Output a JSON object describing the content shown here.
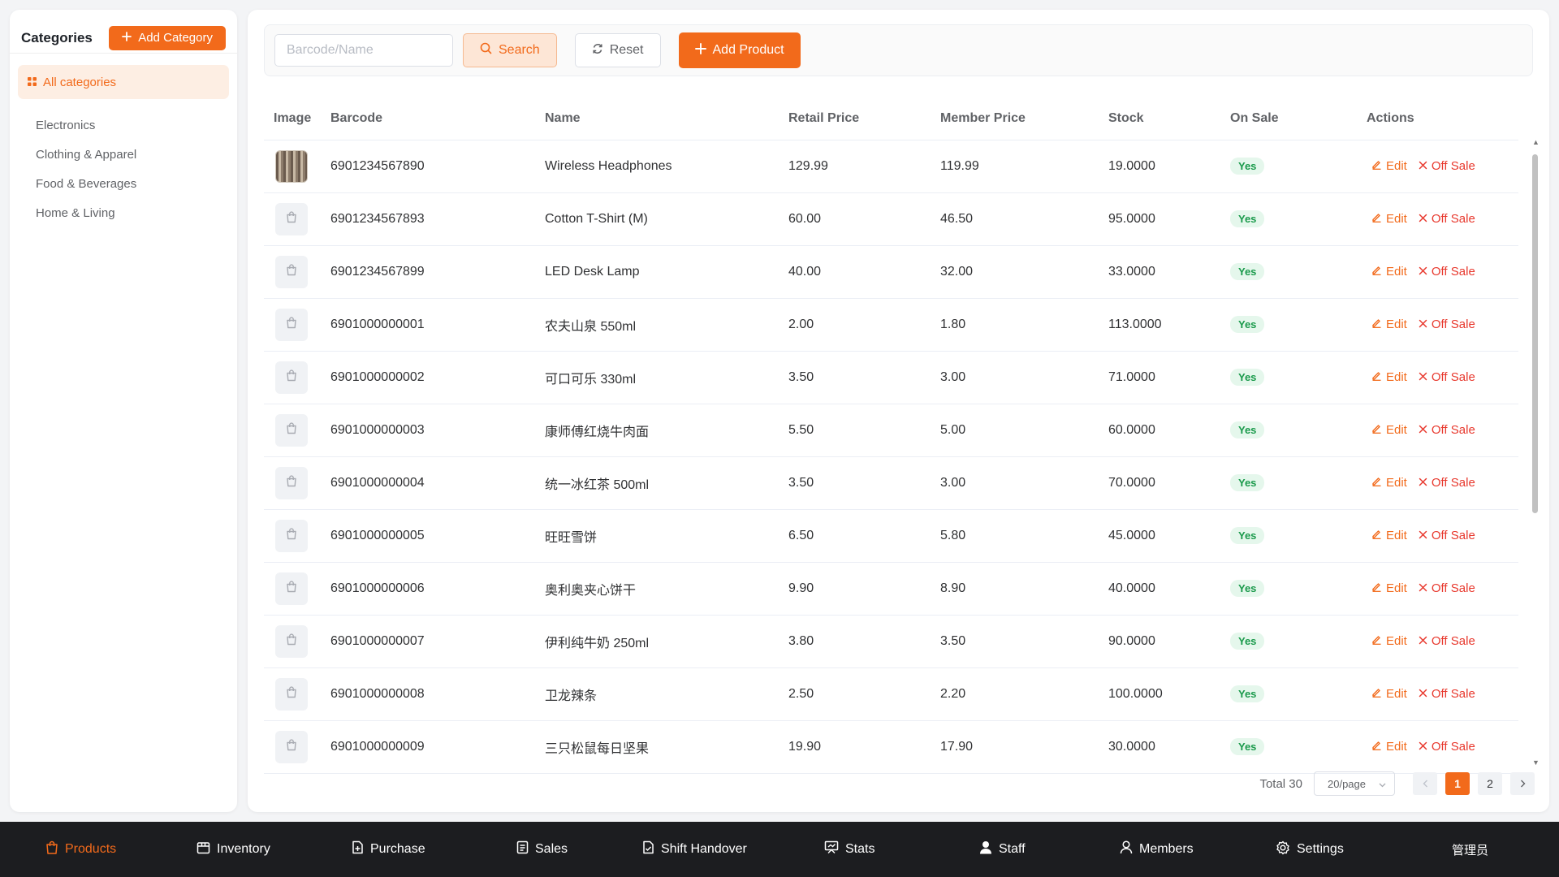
{
  "sidebar": {
    "title": "Categories",
    "add_label": "Add Category",
    "all_label": "All categories",
    "items": [
      {
        "label": "Electronics"
      },
      {
        "label": "Clothing & Apparel"
      },
      {
        "label": "Food & Beverages"
      },
      {
        "label": "Home & Living"
      }
    ]
  },
  "toolbar": {
    "search_placeholder": "Barcode/Name",
    "search_value": "",
    "search_label": "Search",
    "reset_label": "Reset",
    "add_product_label": "Add Product"
  },
  "table": {
    "headers": {
      "image": "Image",
      "barcode": "Barcode",
      "name": "Name",
      "retail": "Retail Price",
      "member": "Member Price",
      "stock": "Stock",
      "on_sale": "On Sale",
      "actions": "Actions"
    },
    "edit_label": "Edit",
    "off_sale_label": "Off Sale",
    "rows": [
      {
        "thumb": "photo",
        "barcode": "6901234567890",
        "name": "Wireless Headphones",
        "retail": "129.99",
        "member": "119.99",
        "stock": "19.0000",
        "on_sale": "Yes"
      },
      {
        "thumb": "bag-icon",
        "barcode": "6901234567893",
        "name": "Cotton T-Shirt (M)",
        "retail": "60.00",
        "member": "46.50",
        "stock": "95.0000",
        "on_sale": "Yes"
      },
      {
        "thumb": "bag-icon",
        "barcode": "6901234567899",
        "name": "LED Desk Lamp",
        "retail": "40.00",
        "member": "32.00",
        "stock": "33.0000",
        "on_sale": "Yes"
      },
      {
        "thumb": "bag-icon",
        "barcode": "6901000000001",
        "name": "农夫山泉 550ml",
        "retail": "2.00",
        "member": "1.80",
        "stock": "113.0000",
        "on_sale": "Yes"
      },
      {
        "thumb": "bag-icon",
        "barcode": "6901000000002",
        "name": "可口可乐 330ml",
        "retail": "3.50",
        "member": "3.00",
        "stock": "71.0000",
        "on_sale": "Yes"
      },
      {
        "thumb": "bag-icon",
        "barcode": "6901000000003",
        "name": "康师傅红烧牛肉面",
        "retail": "5.50",
        "member": "5.00",
        "stock": "60.0000",
        "on_sale": "Yes"
      },
      {
        "thumb": "bag-icon",
        "barcode": "6901000000004",
        "name": "统一冰红茶 500ml",
        "retail": "3.50",
        "member": "3.00",
        "stock": "70.0000",
        "on_sale": "Yes"
      },
      {
        "thumb": "bag-icon",
        "barcode": "6901000000005",
        "name": "旺旺雪饼",
        "retail": "6.50",
        "member": "5.80",
        "stock": "45.0000",
        "on_sale": "Yes"
      },
      {
        "thumb": "bag-icon",
        "barcode": "6901000000006",
        "name": "奥利奥夹心饼干",
        "retail": "9.90",
        "member": "8.90",
        "stock": "40.0000",
        "on_sale": "Yes"
      },
      {
        "thumb": "bag-icon",
        "barcode": "6901000000007",
        "name": "伊利纯牛奶 250ml",
        "retail": "3.80",
        "member": "3.50",
        "stock": "90.0000",
        "on_sale": "Yes"
      },
      {
        "thumb": "bag-icon",
        "barcode": "6901000000008",
        "name": "卫龙辣条",
        "retail": "2.50",
        "member": "2.20",
        "stock": "100.0000",
        "on_sale": "Yes"
      },
      {
        "thumb": "bag-icon",
        "barcode": "6901000000009",
        "name": "三只松鼠每日坚果",
        "retail": "19.90",
        "member": "17.90",
        "stock": "30.0000",
        "on_sale": "Yes"
      }
    ]
  },
  "pagination": {
    "total_label": "Total 30",
    "page_size": "20/page",
    "pages": [
      "1",
      "2"
    ],
    "current": "1"
  },
  "bottom_nav": {
    "items": [
      {
        "label": "Products",
        "icon": "bag-icon",
        "active": true
      },
      {
        "label": "Inventory",
        "icon": "box-icon",
        "active": false
      },
      {
        "label": "Purchase",
        "icon": "document-plus-icon",
        "active": false
      },
      {
        "label": "Sales",
        "icon": "list-document-icon",
        "active": false
      },
      {
        "label": "Shift Handover",
        "icon": "document-check-icon",
        "active": false
      },
      {
        "label": "Stats",
        "icon": "chart-board-icon",
        "active": false
      },
      {
        "label": "Staff",
        "icon": "user-filled-icon",
        "active": false
      },
      {
        "label": "Members",
        "icon": "user-outline-icon",
        "active": false
      },
      {
        "label": "Settings",
        "icon": "gear-icon",
        "active": false
      }
    ],
    "user_label": "管理员"
  },
  "colors": {
    "accent": "#f26a1b",
    "danger": "#e8382d",
    "success": "#1a9a4b",
    "nav_bg": "#1c1d20"
  }
}
